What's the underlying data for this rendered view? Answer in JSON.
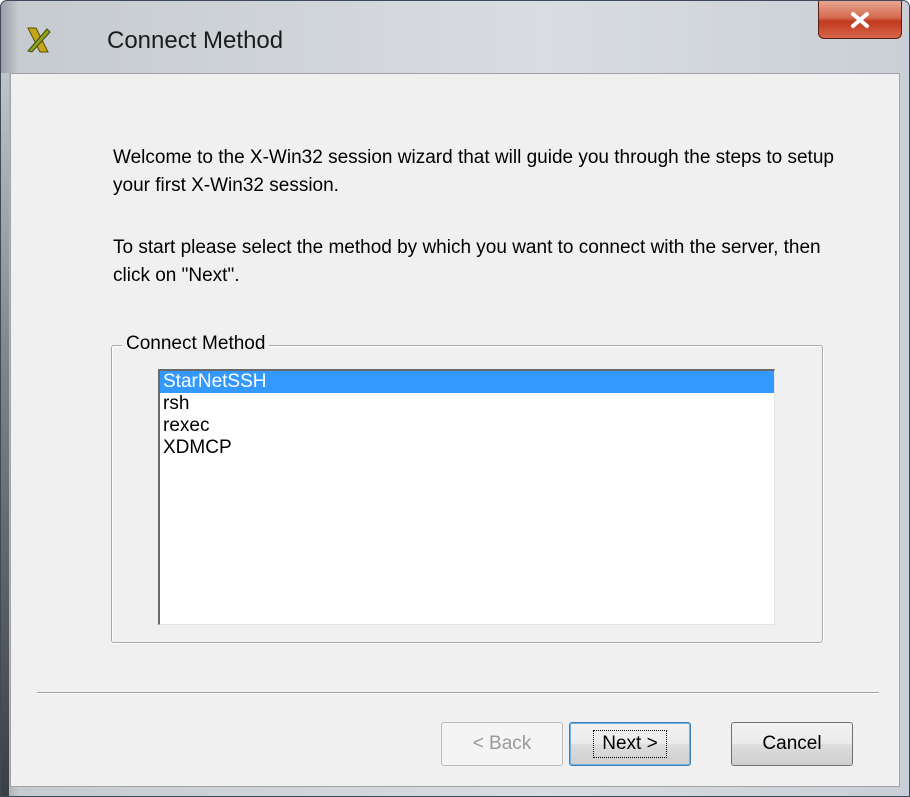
{
  "window": {
    "title": "Connect Method",
    "icon": "x-win32-icon",
    "close_icon": "close-icon"
  },
  "intro": {
    "paragraph1": "Welcome to the X-Win32 session wizard that will guide you through the steps to setup your first X-Win32 session.",
    "paragraph2": "To start please select the method by which you want to connect with the server, then click on \"Next\"."
  },
  "group": {
    "label": "Connect Method",
    "items": [
      {
        "label": "StarNetSSH",
        "selected": true
      },
      {
        "label": "rsh",
        "selected": false
      },
      {
        "label": "rexec",
        "selected": false
      },
      {
        "label": "XDMCP",
        "selected": false
      }
    ]
  },
  "buttons": {
    "back": "< Back",
    "next": "Next >",
    "cancel": "Cancel"
  },
  "colors": {
    "selection": "#3399ff",
    "close_button": "#c7462a"
  }
}
